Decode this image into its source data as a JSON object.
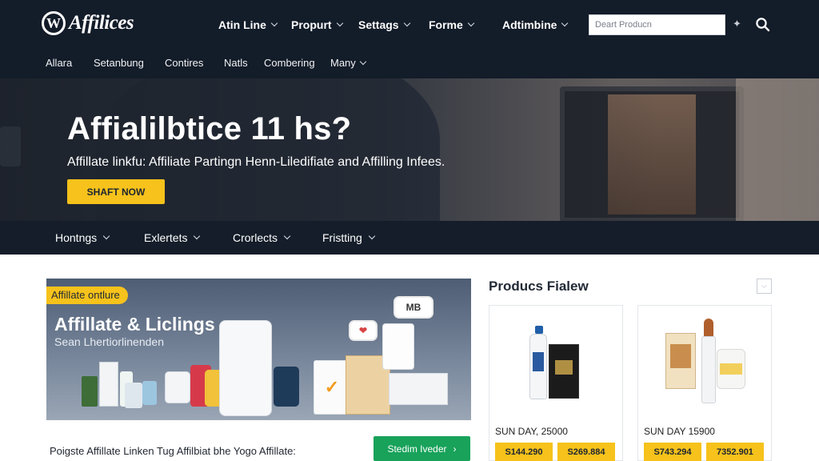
{
  "brand": {
    "name": "Affilices",
    "mark": "W"
  },
  "main_nav": [
    "Atin Line",
    "Propurt",
    "Settags",
    "Forme",
    "Adtimbine"
  ],
  "search": {
    "placeholder": "Deart Producn"
  },
  "sub_nav": [
    "Allara",
    "Setanbung",
    "Contires",
    "Natls",
    "Combering",
    "Many"
  ],
  "hero": {
    "title": "Affialilbtice 11 hs?",
    "subtitle": "Affillate linkfu: Affiliate Partingn Henn-Liledifiate and Affilling Infees.",
    "cta": "SHAFT NOW"
  },
  "category_bar": [
    "Hontngs",
    "Exlertets",
    "Crorlects",
    "Fristting"
  ],
  "banner": {
    "tag": "Affillate ontlure",
    "title": "Affillate & Liclings",
    "subtitle": "Sean Lhertiorlinenden",
    "bubble_1": "MB",
    "bubble_2": "❤"
  },
  "products_panel": {
    "title": "Producs Fialew",
    "cards": [
      {
        "label": "SUN DAY, 25000",
        "price_1": "S144.290",
        "price_2": "S269.884"
      },
      {
        "label": "SUN DAY 15900",
        "price_1": "S743.294",
        "price_2": "7352.901"
      }
    ]
  },
  "bottom": {
    "text": "Poigste Affillate Linken Tug Affilbiat bhe Yogo Affillate:",
    "button": "Stedim Iveder"
  },
  "colors": {
    "nav_bg": "#131c29",
    "accent_yellow": "#f6c21b",
    "accent_green": "#18a25a"
  }
}
